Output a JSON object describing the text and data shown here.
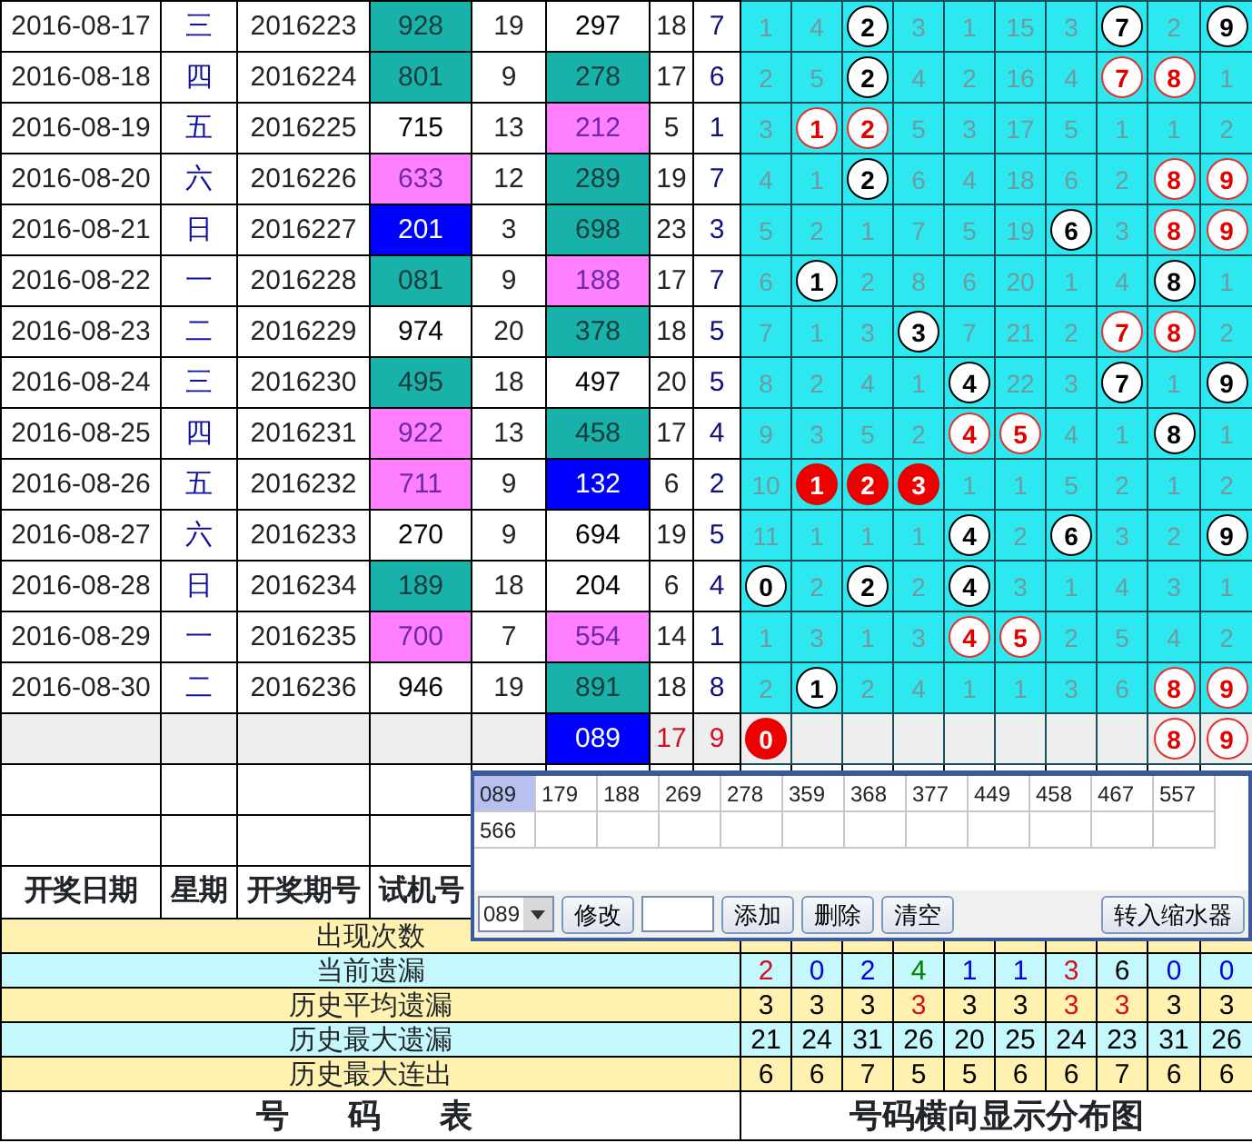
{
  "rows": [
    {
      "date": "2016-08-17",
      "weekday": "三",
      "draw_period": "2016223",
      "test_number": {
        "text": "928",
        "color": "#19b2aa"
      },
      "column_5": "19",
      "column_6": {
        "text": "297",
        "color": "#ffffff"
      },
      "column_7": "18",
      "column_8": "7",
      "digits": [
        {
          "kind": "miss",
          "text": "1"
        },
        {
          "kind": "miss",
          "text": "4"
        },
        {
          "kind": "hit",
          "text": "2"
        },
        {
          "kind": "miss",
          "text": "3"
        },
        {
          "kind": "miss",
          "text": "1"
        },
        {
          "kind": "miss",
          "text": "15"
        },
        {
          "kind": "miss",
          "text": "3"
        },
        {
          "kind": "hit",
          "text": "7"
        },
        {
          "kind": "miss",
          "text": "2"
        },
        {
          "kind": "hit",
          "text": "9"
        }
      ]
    },
    {
      "date": "2016-08-18",
      "weekday": "四",
      "draw_period": "2016224",
      "test_number": {
        "text": "801",
        "color": "#19b2aa"
      },
      "column_5": "9",
      "column_6": {
        "text": "278",
        "color": "#19b2aa"
      },
      "column_7": "17",
      "column_8": "6",
      "digits": [
        {
          "kind": "miss",
          "text": "2"
        },
        {
          "kind": "miss",
          "text": "5"
        },
        {
          "kind": "hit",
          "text": "2"
        },
        {
          "kind": "miss",
          "text": "4"
        },
        {
          "kind": "miss",
          "text": "2"
        },
        {
          "kind": "miss",
          "text": "16"
        },
        {
          "kind": "miss",
          "text": "4"
        },
        {
          "kind": "repeat",
          "text": "7"
        },
        {
          "kind": "repeat",
          "text": "8"
        },
        {
          "kind": "miss",
          "text": "1"
        }
      ]
    },
    {
      "date": "2016-08-19",
      "weekday": "五",
      "draw_period": "2016225",
      "test_number": {
        "text": "715",
        "color": "#ffffff"
      },
      "column_5": "13",
      "column_6": {
        "text": "212",
        "color": "#ff80ff"
      },
      "column_7": "5",
      "column_8": "1",
      "digits": [
        {
          "kind": "miss",
          "text": "3"
        },
        {
          "kind": "repeat",
          "text": "1"
        },
        {
          "kind": "repeat",
          "text": "2"
        },
        {
          "kind": "miss",
          "text": "5"
        },
        {
          "kind": "miss",
          "text": "3"
        },
        {
          "kind": "miss",
          "text": "17"
        },
        {
          "kind": "miss",
          "text": "5"
        },
        {
          "kind": "miss",
          "text": "1"
        },
        {
          "kind": "miss",
          "text": "1"
        },
        {
          "kind": "miss",
          "text": "2"
        }
      ]
    },
    {
      "date": "2016-08-20",
      "weekday": "六",
      "draw_period": "2016226",
      "test_number": {
        "text": "633",
        "color": "#ff80ff"
      },
      "column_5": "12",
      "column_6": {
        "text": "289",
        "color": "#19b2aa"
      },
      "column_7": "19",
      "column_8": "7",
      "digits": [
        {
          "kind": "miss",
          "text": "4"
        },
        {
          "kind": "miss",
          "text": "1"
        },
        {
          "kind": "hit",
          "text": "2"
        },
        {
          "kind": "miss",
          "text": "6"
        },
        {
          "kind": "miss",
          "text": "4"
        },
        {
          "kind": "miss",
          "text": "18"
        },
        {
          "kind": "miss",
          "text": "6"
        },
        {
          "kind": "miss",
          "text": "2"
        },
        {
          "kind": "repeat",
          "text": "8"
        },
        {
          "kind": "repeat",
          "text": "9"
        }
      ]
    },
    {
      "date": "2016-08-21",
      "weekday": "日",
      "draw_period": "2016227",
      "test_number": {
        "text": "201",
        "color": "#0000ff"
      },
      "column_5": "3",
      "column_6": {
        "text": "698",
        "color": "#19b2aa"
      },
      "column_7": "23",
      "column_8": "3",
      "digits": [
        {
          "kind": "miss",
          "text": "5"
        },
        {
          "kind": "miss",
          "text": "2"
        },
        {
          "kind": "miss",
          "text": "1"
        },
        {
          "kind": "miss",
          "text": "7"
        },
        {
          "kind": "miss",
          "text": "5"
        },
        {
          "kind": "miss",
          "text": "19"
        },
        {
          "kind": "hit",
          "text": "6"
        },
        {
          "kind": "miss",
          "text": "3"
        },
        {
          "kind": "repeat",
          "text": "8"
        },
        {
          "kind": "repeat",
          "text": "9"
        }
      ]
    },
    {
      "date": "2016-08-22",
      "weekday": "一",
      "draw_period": "2016228",
      "test_number": {
        "text": "081",
        "color": "#19b2aa"
      },
      "column_5": "9",
      "column_6": {
        "text": "188",
        "color": "#ff80ff"
      },
      "column_7": "17",
      "column_8": "7",
      "digits": [
        {
          "kind": "miss",
          "text": "6"
        },
        {
          "kind": "hit",
          "text": "1"
        },
        {
          "kind": "miss",
          "text": "2"
        },
        {
          "kind": "miss",
          "text": "8"
        },
        {
          "kind": "miss",
          "text": "6"
        },
        {
          "kind": "miss",
          "text": "20"
        },
        {
          "kind": "miss",
          "text": "1"
        },
        {
          "kind": "miss",
          "text": "4"
        },
        {
          "kind": "hit",
          "text": "8"
        },
        {
          "kind": "miss",
          "text": "1"
        }
      ]
    },
    {
      "date": "2016-08-23",
      "weekday": "二",
      "draw_period": "2016229",
      "test_number": {
        "text": "974",
        "color": "#ffffff"
      },
      "column_5": "20",
      "column_6": {
        "text": "378",
        "color": "#19b2aa"
      },
      "column_7": "18",
      "column_8": "5",
      "digits": [
        {
          "kind": "miss",
          "text": "7"
        },
        {
          "kind": "miss",
          "text": "1"
        },
        {
          "kind": "miss",
          "text": "3"
        },
        {
          "kind": "hit",
          "text": "3"
        },
        {
          "kind": "miss",
          "text": "7"
        },
        {
          "kind": "miss",
          "text": "21"
        },
        {
          "kind": "miss",
          "text": "2"
        },
        {
          "kind": "repeat",
          "text": "7"
        },
        {
          "kind": "repeat",
          "text": "8"
        },
        {
          "kind": "miss",
          "text": "2"
        }
      ]
    },
    {
      "date": "2016-08-24",
      "weekday": "三",
      "draw_period": "2016230",
      "test_number": {
        "text": "495",
        "color": "#19b2aa"
      },
      "column_5": "18",
      "column_6": {
        "text": "497",
        "color": "#ffffff"
      },
      "column_7": "20",
      "column_8": "5",
      "digits": [
        {
          "kind": "miss",
          "text": "8"
        },
        {
          "kind": "miss",
          "text": "2"
        },
        {
          "kind": "miss",
          "text": "4"
        },
        {
          "kind": "miss",
          "text": "1"
        },
        {
          "kind": "hit",
          "text": "4"
        },
        {
          "kind": "miss",
          "text": "22"
        },
        {
          "kind": "miss",
          "text": "3"
        },
        {
          "kind": "hit",
          "text": "7"
        },
        {
          "kind": "miss",
          "text": "1"
        },
        {
          "kind": "hit",
          "text": "9"
        }
      ]
    },
    {
      "date": "2016-08-25",
      "weekday": "四",
      "draw_period": "2016231",
      "test_number": {
        "text": "922",
        "color": "#ff80ff"
      },
      "column_5": "13",
      "column_6": {
        "text": "458",
        "color": "#19b2aa"
      },
      "column_7": "17",
      "column_8": "4",
      "digits": [
        {
          "kind": "miss",
          "text": "9"
        },
        {
          "kind": "miss",
          "text": "3"
        },
        {
          "kind": "miss",
          "text": "5"
        },
        {
          "kind": "miss",
          "text": "2"
        },
        {
          "kind": "repeat",
          "text": "4"
        },
        {
          "kind": "repeat",
          "text": "5"
        },
        {
          "kind": "miss",
          "text": "4"
        },
        {
          "kind": "miss",
          "text": "1"
        },
        {
          "kind": "hit",
          "text": "8"
        },
        {
          "kind": "miss",
          "text": "1"
        }
      ]
    },
    {
      "date": "2016-08-26",
      "weekday": "五",
      "draw_period": "2016232",
      "test_number": {
        "text": "711",
        "color": "#ff80ff"
      },
      "column_5": "9",
      "column_6": {
        "text": "132",
        "color": "#0000ff"
      },
      "column_7": "6",
      "column_8": "2",
      "digits": [
        {
          "kind": "miss",
          "text": "10"
        },
        {
          "kind": "solid",
          "text": "1"
        },
        {
          "kind": "solid",
          "text": "2"
        },
        {
          "kind": "solid",
          "text": "3"
        },
        {
          "kind": "miss",
          "text": "1"
        },
        {
          "kind": "miss",
          "text": "1"
        },
        {
          "kind": "miss",
          "text": "5"
        },
        {
          "kind": "miss",
          "text": "2"
        },
        {
          "kind": "miss",
          "text": "1"
        },
        {
          "kind": "miss",
          "text": "2"
        }
      ]
    },
    {
      "date": "2016-08-27",
      "weekday": "六",
      "draw_period": "2016233",
      "test_number": {
        "text": "270",
        "color": "#ffffff"
      },
      "column_5": "9",
      "column_6": {
        "text": "694",
        "color": "#ffffff"
      },
      "column_7": "19",
      "column_8": "5",
      "digits": [
        {
          "kind": "miss",
          "text": "11"
        },
        {
          "kind": "miss",
          "text": "1"
        },
        {
          "kind": "miss",
          "text": "1"
        },
        {
          "kind": "miss",
          "text": "1"
        },
        {
          "kind": "hit",
          "text": "4"
        },
        {
          "kind": "miss",
          "text": "2"
        },
        {
          "kind": "hit",
          "text": "6"
        },
        {
          "kind": "miss",
          "text": "3"
        },
        {
          "kind": "miss",
          "text": "2"
        },
        {
          "kind": "hit",
          "text": "9"
        }
      ]
    },
    {
      "date": "2016-08-28",
      "weekday": "日",
      "draw_period": "2016234",
      "test_number": {
        "text": "189",
        "color": "#19b2aa"
      },
      "column_5": "18",
      "column_6": {
        "text": "204",
        "color": "#ffffff"
      },
      "column_7": "6",
      "column_8": "4",
      "digits": [
        {
          "kind": "hit",
          "text": "0"
        },
        {
          "kind": "miss",
          "text": "2"
        },
        {
          "kind": "hit",
          "text": "2"
        },
        {
          "kind": "miss",
          "text": "2"
        },
        {
          "kind": "hit",
          "text": "4"
        },
        {
          "kind": "miss",
          "text": "3"
        },
        {
          "kind": "miss",
          "text": "1"
        },
        {
          "kind": "miss",
          "text": "4"
        },
        {
          "kind": "miss",
          "text": "3"
        },
        {
          "kind": "miss",
          "text": "1"
        }
      ]
    },
    {
      "date": "2016-08-29",
      "weekday": "一",
      "draw_period": "2016235",
      "test_number": {
        "text": "700",
        "color": "#ff80ff"
      },
      "column_5": "7",
      "column_6": {
        "text": "554",
        "color": "#ff80ff"
      },
      "column_7": "14",
      "column_8": "1",
      "digits": [
        {
          "kind": "miss",
          "text": "1"
        },
        {
          "kind": "miss",
          "text": "3"
        },
        {
          "kind": "miss",
          "text": "1"
        },
        {
          "kind": "miss",
          "text": "3"
        },
        {
          "kind": "repeat",
          "text": "4"
        },
        {
          "kind": "repeat",
          "text": "5"
        },
        {
          "kind": "miss",
          "text": "2"
        },
        {
          "kind": "miss",
          "text": "5"
        },
        {
          "kind": "miss",
          "text": "4"
        },
        {
          "kind": "miss",
          "text": "2"
        }
      ]
    },
    {
      "date": "2016-08-30",
      "weekday": "二",
      "draw_period": "2016236",
      "test_number": {
        "text": "946",
        "color": "#ffffff"
      },
      "column_5": "19",
      "column_6": {
        "text": "891",
        "color": "#19b2aa"
      },
      "column_7": "18",
      "column_8": "8",
      "digits": [
        {
          "kind": "miss",
          "text": "2"
        },
        {
          "kind": "hit",
          "text": "1"
        },
        {
          "kind": "miss",
          "text": "2"
        },
        {
          "kind": "miss",
          "text": "4"
        },
        {
          "kind": "miss",
          "text": "1"
        },
        {
          "kind": "miss",
          "text": "1"
        },
        {
          "kind": "miss",
          "text": "3"
        },
        {
          "kind": "miss",
          "text": "6"
        },
        {
          "kind": "repeat",
          "text": "8"
        },
        {
          "kind": "repeat",
          "text": "9"
        }
      ]
    }
  ],
  "pending_row": {
    "column_6": {
      "text": "089",
      "color": "#0000ff"
    },
    "column_7": "17",
    "column_8": "9",
    "digits": [
      {
        "kind": "solid",
        "text": "0"
      },
      {
        "kind": "empty"
      },
      {
        "kind": "empty"
      },
      {
        "kind": "empty"
      },
      {
        "kind": "empty"
      },
      {
        "kind": "empty"
      },
      {
        "kind": "empty"
      },
      {
        "kind": "empty"
      },
      {
        "kind": "repeat",
        "text": "8"
      },
      {
        "kind": "repeat",
        "text": "9"
      }
    ]
  },
  "headers": [
    "开奖日期",
    "星期",
    "开奖期号",
    "试机号"
  ],
  "stats": [
    {
      "label": "出现次数"
    },
    {
      "label": "当前遗漏",
      "values": [
        {
          "text": "2",
          "color": "#d01020"
        },
        {
          "text": "0",
          "color": "#0000e0"
        },
        {
          "text": "2",
          "color": "#0000e0"
        },
        {
          "text": "4",
          "color": "#008000"
        },
        {
          "text": "1",
          "color": "#0000e0"
        },
        {
          "text": "1",
          "color": "#0000e0"
        },
        {
          "text": "3",
          "color": "#d01020"
        },
        {
          "text": "6",
          "color": "#000000"
        },
        {
          "text": "0",
          "color": "#0000e0"
        },
        {
          "text": "0",
          "color": "#0000e0"
        }
      ]
    },
    {
      "label": "历史平均遗漏",
      "values": [
        {
          "text": "3",
          "color": "#000000"
        },
        {
          "text": "3",
          "color": "#000000"
        },
        {
          "text": "3",
          "color": "#000000"
        },
        {
          "text": "3",
          "color": "#d01020"
        },
        {
          "text": "3",
          "color": "#000000"
        },
        {
          "text": "3",
          "color": "#000000"
        },
        {
          "text": "3",
          "color": "#d01020"
        },
        {
          "text": "3",
          "color": "#d01020"
        },
        {
          "text": "3",
          "color": "#000000"
        },
        {
          "text": "3",
          "color": "#000000"
        }
      ]
    },
    {
      "label": "历史最大遗漏",
      "values": [
        {
          "text": "21",
          "color": "#000000"
        },
        {
          "text": "24",
          "color": "#000000"
        },
        {
          "text": "31",
          "color": "#000000"
        },
        {
          "text": "26",
          "color": "#000000"
        },
        {
          "text": "20",
          "color": "#000000"
        },
        {
          "text": "25",
          "color": "#000000"
        },
        {
          "text": "24",
          "color": "#000000"
        },
        {
          "text": "23",
          "color": "#000000"
        },
        {
          "text": "31",
          "color": "#000000"
        },
        {
          "text": "26",
          "color": "#000000"
        }
      ]
    },
    {
      "label": "历史最大连出",
      "values": [
        {
          "text": "6",
          "color": "#000000"
        },
        {
          "text": "6",
          "color": "#000000"
        },
        {
          "text": "7",
          "color": "#000000"
        },
        {
          "text": "5",
          "color": "#000000"
        },
        {
          "text": "5",
          "color": "#000000"
        },
        {
          "text": "6",
          "color": "#000000"
        },
        {
          "text": "6",
          "color": "#000000"
        },
        {
          "text": "7",
          "color": "#000000"
        },
        {
          "text": "6",
          "color": "#000000"
        },
        {
          "text": "6",
          "color": "#000000"
        }
      ]
    }
  ],
  "footer": {
    "left": "号　码　表",
    "right": "号码横向显示分布图"
  },
  "popup": {
    "numbers": [
      {
        "text": "089",
        "selected": true
      },
      {
        "text": "179",
        "selected": false
      },
      {
        "text": "188",
        "selected": false
      },
      {
        "text": "269",
        "selected": false
      },
      {
        "text": "278",
        "selected": false
      },
      {
        "text": "359",
        "selected": false
      },
      {
        "text": "368",
        "selected": false
      },
      {
        "text": "377",
        "selected": false
      },
      {
        "text": "449",
        "selected": false
      },
      {
        "text": "458",
        "selected": false
      },
      {
        "text": "467",
        "selected": false
      },
      {
        "text": "557",
        "selected": false
      },
      {
        "text": "566",
        "selected": false
      }
    ],
    "select_value": "089",
    "edit_button": "修改",
    "buttons": [
      "添加",
      "删除",
      "清空"
    ],
    "transfer_button": "转入缩水器"
  }
}
